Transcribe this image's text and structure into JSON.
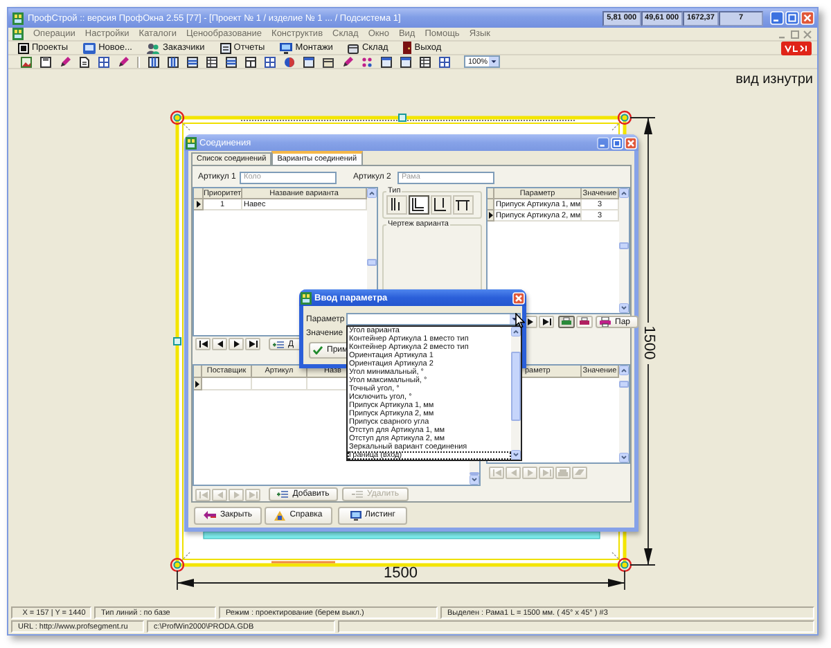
{
  "app_window": {
    "title": "ПрофСтрой :: версия ПрофОкна 2.55 [77] - [Проект № 1 / изделие № 1 ... / Подсистема 1]",
    "indicators": [
      "5,81 000",
      "49,61 000",
      "1672,37",
      "7"
    ]
  },
  "menu": [
    "Операции",
    "Настройки",
    "Каталоги",
    "Ценообразование",
    "Конструктив",
    "Склад",
    "Окно",
    "Вид",
    "Помощь",
    "Язык"
  ],
  "toolbar": [
    {
      "label": "Проекты",
      "kind": "projects"
    },
    {
      "label": "Новое...",
      "kind": "new"
    },
    {
      "label": "Заказчики",
      "kind": "customers"
    },
    {
      "label": "Отчеты",
      "kind": "reports"
    },
    {
      "label": "Монтажи",
      "kind": "installs"
    },
    {
      "label": "Склад",
      "kind": "warehouse"
    },
    {
      "label": "Выход",
      "kind": "exit"
    }
  ],
  "zoom_select": {
    "value": "100%"
  },
  "canvas": {
    "view_label": "вид изнутри",
    "width_dimension": "1500",
    "height_dimension": "1500"
  },
  "connections_dialog": {
    "title": "Соединения",
    "tabs": [
      {
        "label": "Список соединений",
        "selected": false
      },
      {
        "label": "Варианты соединений",
        "selected": true
      }
    ],
    "article_fields": [
      {
        "label": "Артикул 1",
        "placeholder": "Коло"
      },
      {
        "label": "Артикул 2",
        "placeholder": "Рама"
      }
    ],
    "variants_table": {
      "columns": [
        "Приоритет",
        "Название варианта"
      ],
      "rows": [
        {
          "cells": [
            "1",
            "Навес"
          ],
          "current": true
        }
      ]
    },
    "type_group": {
      "title": "Тип",
      "types": [
        {
          "kind": "butt",
          "selected": false
        },
        {
          "kind": "corner",
          "selected": true
        },
        {
          "kind": "tee",
          "selected": false
        },
        {
          "kind": "cap",
          "selected": false
        }
      ]
    },
    "drawing_group": {
      "title": "Чертеж варианта"
    },
    "params_table": {
      "columns": [
        "Параметр",
        "Значение"
      ],
      "rows": [
        {
          "cells": [
            "Припуск Артикула 1, мм",
            "3"
          ],
          "current": false
        },
        {
          "cells": [
            "Припуск Артикула 2, мм",
            "3"
          ],
          "current": true
        }
      ]
    },
    "variants_add_button": "Д",
    "print_toggles": [
      {
        "kind": "preview",
        "selected": true
      },
      {
        "kind": "print",
        "selected": false
      }
    ],
    "params_button": "Пар",
    "parts_table": {
      "columns": [
        "Поставщик",
        "Артикул",
        "Назв"
      ],
      "rows": [
        {
          "current": true
        }
      ],
      "navigation_disabled": true
    },
    "part_params_table": {
      "columns": [
        "раметр",
        "Значение"
      ],
      "navigation_disabled": true
    },
    "parts_buttons": [
      {
        "label": "Добавить",
        "kind": "add",
        "disabled": false
      },
      {
        "label": "Удалить",
        "kind": "delete",
        "disabled": true
      }
    ],
    "footer_buttons": [
      {
        "label": "Закрыть",
        "kind": "close"
      },
      {
        "label": "Справка",
        "kind": "help"
      },
      {
        "label": "Листинг",
        "kind": "listing"
      }
    ]
  },
  "parameter_dialog": {
    "title": "Ввод параметра",
    "parameter_label": "Параметр",
    "value_label": "Значение",
    "apply_button": "Прим",
    "options": [
      {
        "label": "Угол варианта",
        "selected": false
      },
      {
        "label": "Контейнер Артикула 1 вместо тип",
        "selected": false
      },
      {
        "label": "Контейнер Артикула 2 вместо тип",
        "selected": false
      },
      {
        "label": "Ориентация Артикула 1",
        "selected": false
      },
      {
        "label": "Ориентация Артикула 2",
        "selected": false
      },
      {
        "label": "Угол минимальный, °",
        "selected": false
      },
      {
        "label": "Угол максимальный, °",
        "selected": false
      },
      {
        "label": "Точный угол, °",
        "selected": false
      },
      {
        "label": "Исключить угол, °",
        "selected": false
      },
      {
        "label": "Припуск Артикула 1, мм",
        "selected": false
      },
      {
        "label": "Припуск Артикула 2, мм",
        "selected": false
      },
      {
        "label": "Припуск сварного угла",
        "selected": false
      },
      {
        "label": "Отступ для Артикула 1, мм",
        "selected": false
      },
      {
        "label": "Отступ для Артикула 2, мм",
        "selected": false
      },
      {
        "label": "Зеркальный вариант соединения",
        "selected": false
      },
      {
        "label": "Граница (вход)",
        "selected": true
      }
    ]
  },
  "status_bar": {
    "row_1": [
      "X = 157 | Y = 1440",
      "Тип линий : по базе",
      "Режим : проектирование (берем выкл.)",
      "Выделен : Рама1 L = 1500 мм. ( 45° x 45° ) #3"
    ],
    "row_2": [
      "URL : http://www.profsegment.ru",
      "c:\\ProfWin2000\\PRODA.GDB"
    ]
  }
}
